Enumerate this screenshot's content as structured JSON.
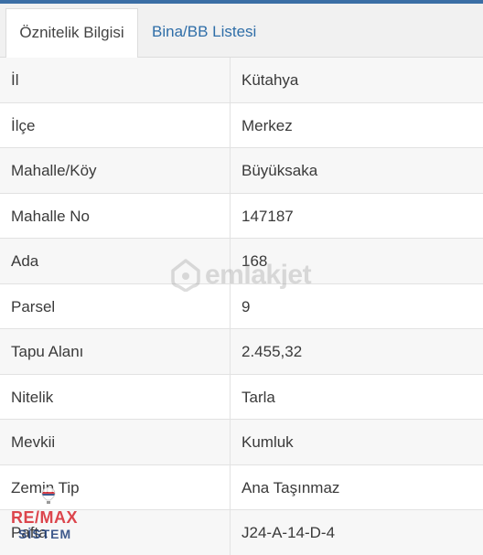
{
  "tabs": [
    {
      "label": "Öznitelik Bilgisi",
      "active": true
    },
    {
      "label": "Bina/BB Listesi",
      "active": false
    }
  ],
  "rows": [
    {
      "label": "İl",
      "value": "Kütahya"
    },
    {
      "label": "İlçe",
      "value": "Merkez"
    },
    {
      "label": "Mahalle/Köy",
      "value": "Büyüksaka"
    },
    {
      "label": "Mahalle No",
      "value": "147187"
    },
    {
      "label": "Ada",
      "value": "168"
    },
    {
      "label": "Parsel",
      "value": "9"
    },
    {
      "label": "Tapu Alanı",
      "value": "2.455,32"
    },
    {
      "label": "Nitelik",
      "value": "Tarla"
    },
    {
      "label": "Mevkii",
      "value": "Kumluk"
    },
    {
      "label": "Zemin Tip",
      "value": "Ana Taşınmaz"
    },
    {
      "label": "Pafta",
      "value": "J24-A-14-D-4"
    }
  ],
  "watermark": {
    "text": "emlakjet",
    "icon": "house-pin-icon"
  },
  "remax_logo": {
    "line1": "RE/MAX",
    "line2": "SİSTEM",
    "icon": "balloon-icon"
  },
  "colors": {
    "accent": "#2f6ea8",
    "topbar": "#3b6ea5",
    "remax_red": "#d8262f",
    "remax_blue": "#1f3f7a"
  }
}
